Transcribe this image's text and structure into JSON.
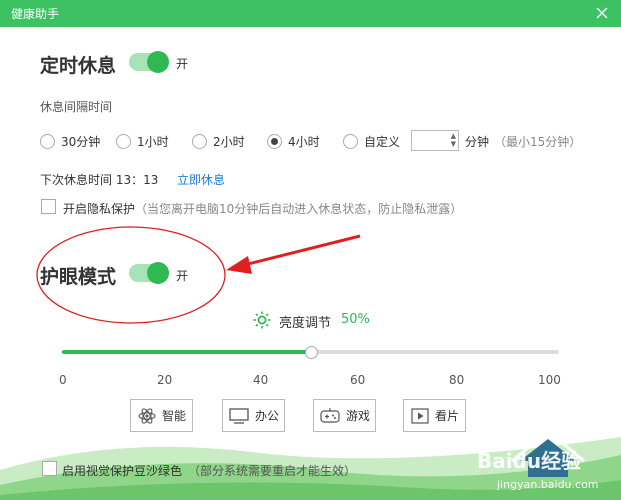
{
  "window": {
    "title": "健康助手"
  },
  "rest": {
    "title": "定时休息",
    "toggle_label": "开",
    "toggle_on": true,
    "interval_label": "休息间隔时间",
    "options": [
      {
        "label": "30分钟",
        "checked": false
      },
      {
        "label": "1小时",
        "checked": false
      },
      {
        "label": "2小时",
        "checked": false
      },
      {
        "label": "4小时",
        "checked": true
      },
      {
        "label": "自定义",
        "checked": false
      }
    ],
    "custom_unit": "分钟",
    "custom_hint": "（最小15分钟）",
    "next_rest_text": "下次休息时间 13：13",
    "rest_now_link": "立即休息",
    "privacy_label": "开启隐私保护",
    "privacy_hint": "（当您离开电脑10分钟后自动进入休息状态，防止隐私泄露）"
  },
  "eye": {
    "title": "护眼模式",
    "toggle_label": "开",
    "toggle_on": true,
    "brightness_label": "亮度调节",
    "brightness_value": "50%",
    "brightness_level": 50,
    "ticks": [
      "0",
      "20",
      "40",
      "60",
      "80",
      "100"
    ],
    "modes": [
      {
        "label": "智能",
        "icon": "atom-icon"
      },
      {
        "label": "办公",
        "icon": "monitor-icon"
      },
      {
        "label": "游戏",
        "icon": "gamepad-icon"
      },
      {
        "label": "看片",
        "icon": "play-icon"
      }
    ],
    "green_label": "启用视觉保护豆沙绿色",
    "green_hint": "（部分系统需要重启才能生效）"
  },
  "watermark": {
    "brand": "Baidu经验",
    "url": "jingyan.baidu.com"
  },
  "colors": {
    "accent": "#2fb853",
    "titlebar": "#3dc263",
    "link": "#1a7ddf",
    "annotation": "#e02020"
  }
}
